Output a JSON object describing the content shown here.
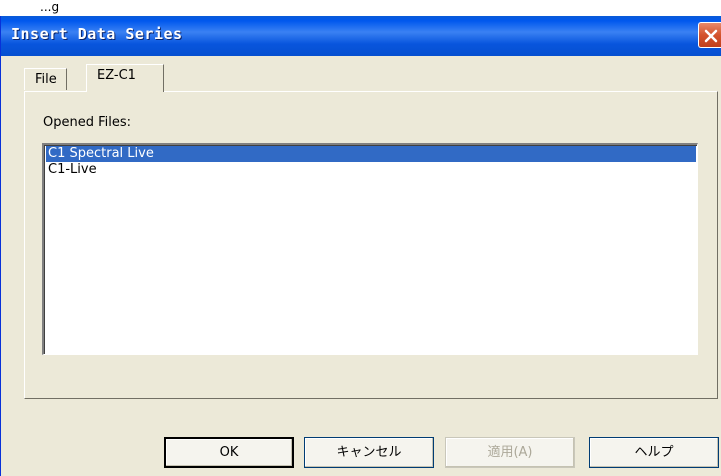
{
  "background_title": "...g",
  "window": {
    "title": "Insert Data Series"
  },
  "tabs": [
    {
      "label": "File"
    },
    {
      "label": "EZ-C1"
    }
  ],
  "panel": {
    "label": "Opened Files:",
    "files": [
      {
        "name": "C1 Spectral Live",
        "selected": true
      },
      {
        "name": "C1-Live",
        "selected": false
      }
    ]
  },
  "buttons": {
    "ok": "OK",
    "cancel": "キャンセル",
    "apply": "適用(A)",
    "help": "ヘルプ"
  },
  "colors": {
    "titlebar": "#0058ee",
    "selection": "#316ac5",
    "close": "#d4532d",
    "dialog_bg": "#ece9d8"
  }
}
